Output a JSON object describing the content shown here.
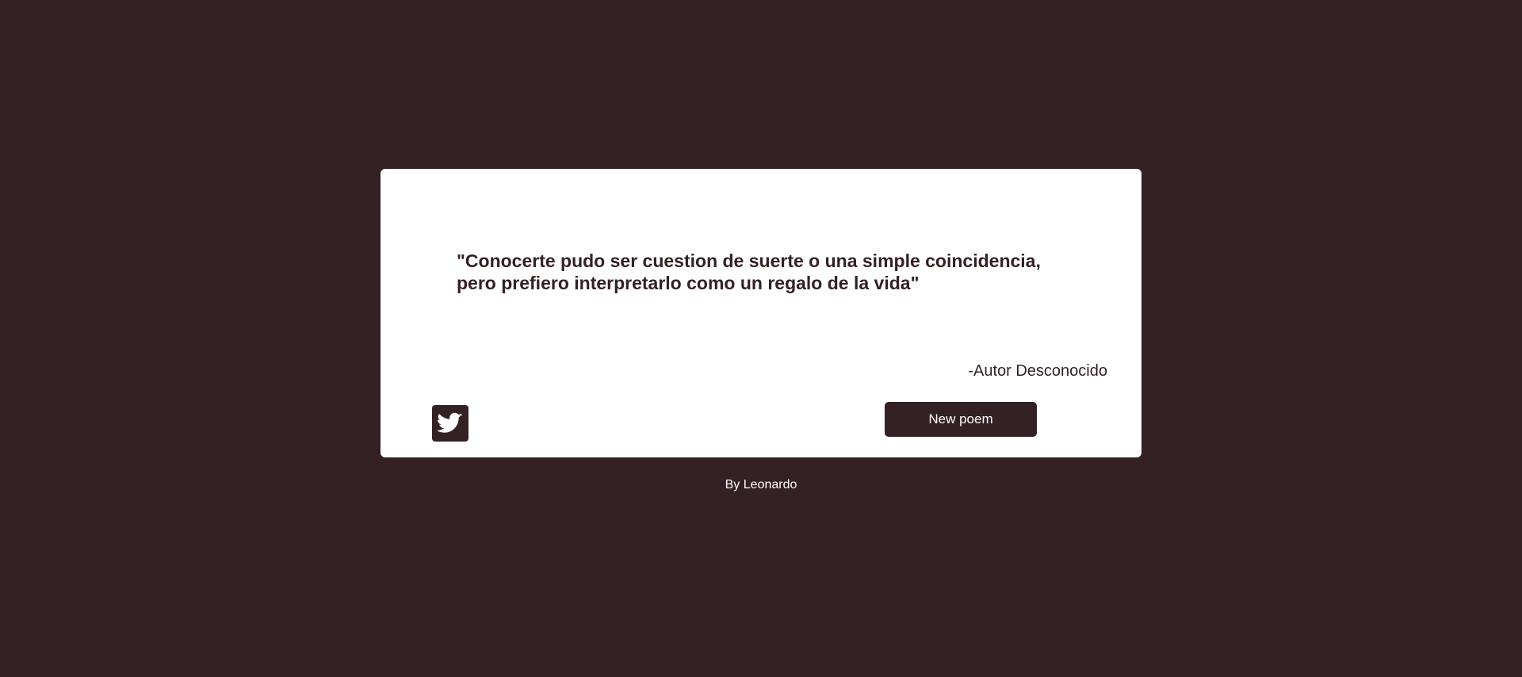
{
  "quote": {
    "text": "\"Conocerte pudo ser cuestion de suerte o una simple coincidencia, pero prefiero interpretarlo como un regalo de la vida\"",
    "author": "-Autor Desconocido"
  },
  "actions": {
    "tweet_icon": "twitter-bird-icon",
    "new_poem_label": "New poem"
  },
  "footer": {
    "credit": "By Leonardo"
  },
  "colors": {
    "background": "#342124",
    "card": "#ffffff",
    "accent": "#342124",
    "button_text": "#ffffff"
  }
}
